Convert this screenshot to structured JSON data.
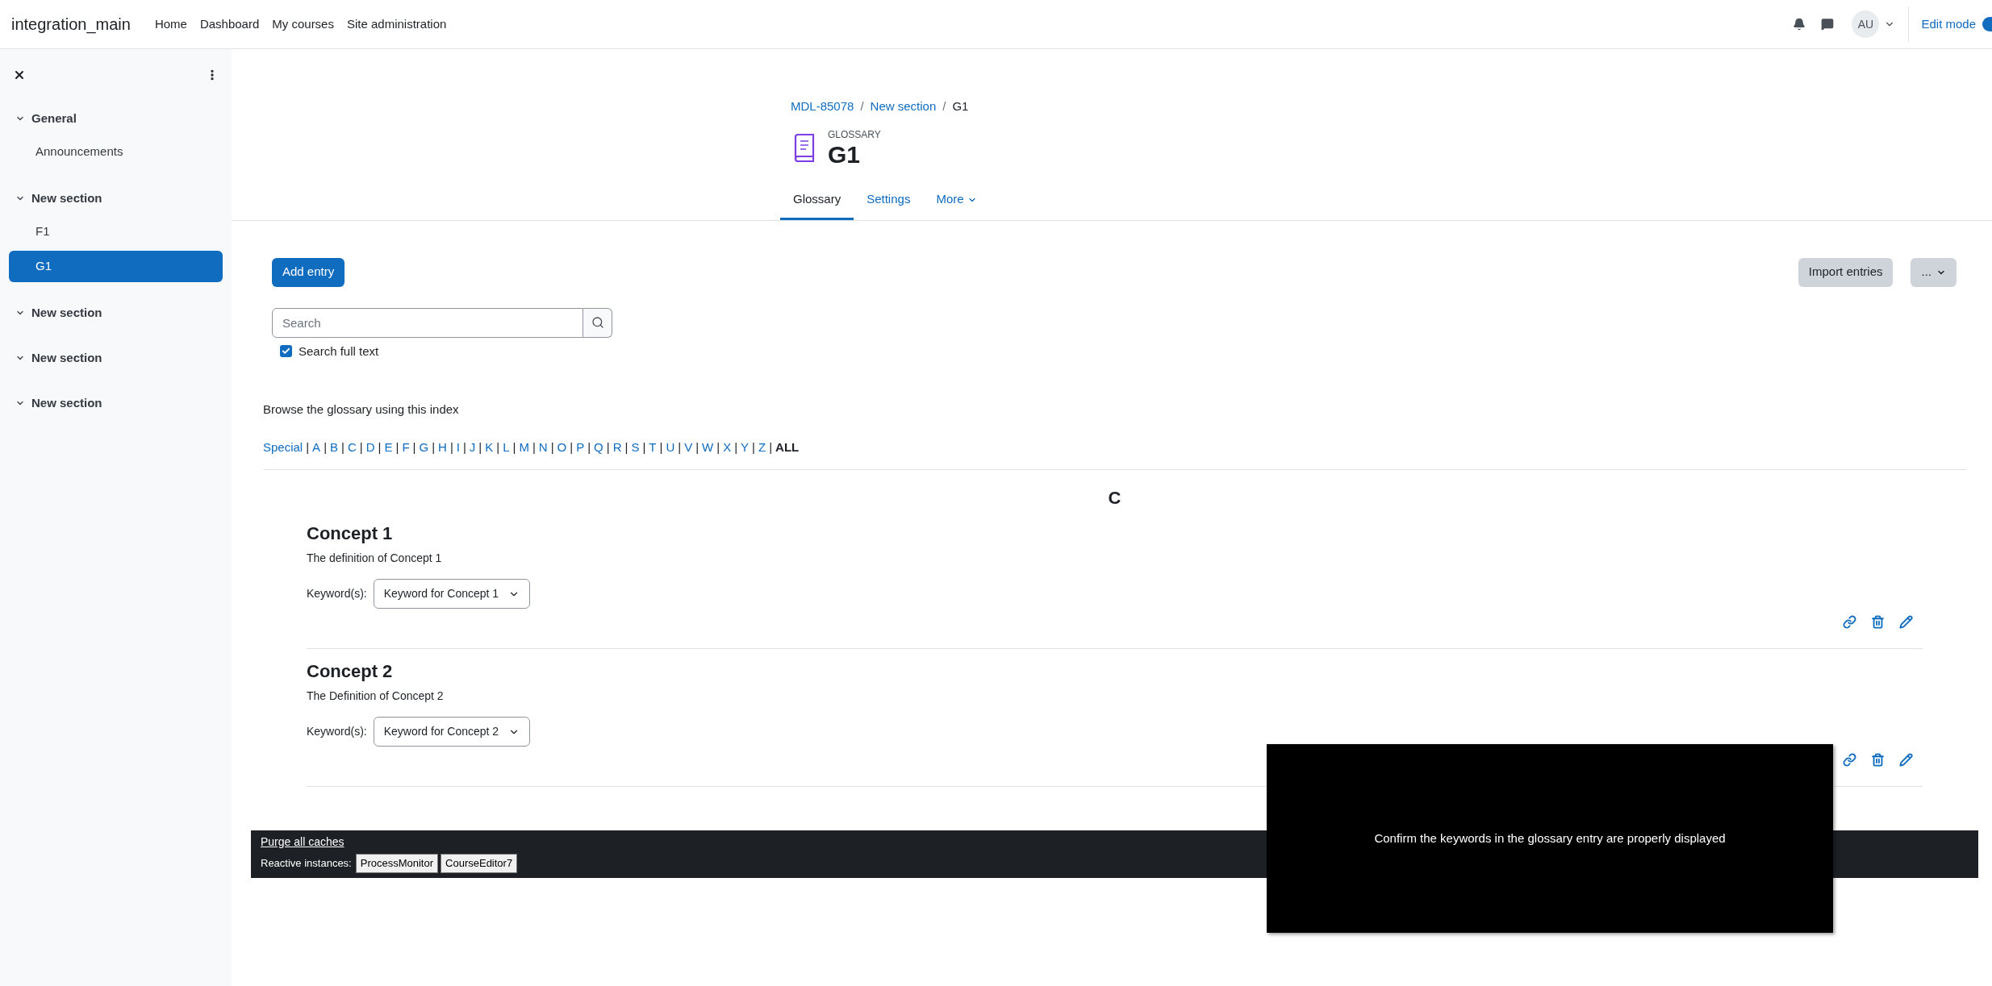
{
  "header": {
    "brand": "integration_main",
    "nav": [
      "Home",
      "Dashboard",
      "My courses",
      "Site administration"
    ],
    "avatar": "AU",
    "edit_mode": {
      "label": "Edit mode",
      "on": true
    }
  },
  "sidebar": {
    "sections": [
      {
        "title": "General",
        "expanded": true,
        "items": [
          {
            "label": "Announcements",
            "selected": false
          }
        ]
      },
      {
        "title": "New section",
        "expanded": true,
        "items": [
          {
            "label": "F1",
            "selected": false
          },
          {
            "label": "G1",
            "selected": true
          }
        ]
      },
      {
        "title": "New section",
        "expanded": true
      },
      {
        "title": "New section",
        "expanded": true
      },
      {
        "title": "New section",
        "expanded": true
      }
    ]
  },
  "page": {
    "breadcrumbs": [
      "MDL-85078",
      "New section",
      "G1"
    ],
    "breadcrumb_separator": "/",
    "module_type": "GLOSSARY",
    "title": "G1",
    "tabs": [
      {
        "label": "Glossary",
        "selected": true,
        "kind": "link"
      },
      {
        "label": "Settings",
        "selected": false,
        "kind": "link"
      },
      {
        "label": "More",
        "selected": false,
        "kind": "dropdown"
      }
    ]
  },
  "actions": {
    "add_entry": "Add entry",
    "import_entries": "Import entries",
    "more_menu": "..."
  },
  "search": {
    "placeholder": "Search",
    "full_text": {
      "label": "Search full text",
      "checked": true
    }
  },
  "index": {
    "caption": "Browse the glossary using this index",
    "separator": "|",
    "letters": [
      {
        "label": "Special",
        "selected": false
      },
      {
        "label": "A",
        "selected": false
      },
      {
        "label": "B",
        "selected": false
      },
      {
        "label": "C",
        "selected": false
      },
      {
        "label": "D",
        "selected": false
      },
      {
        "label": "E",
        "selected": false
      },
      {
        "label": "F",
        "selected": false
      },
      {
        "label": "G",
        "selected": false
      },
      {
        "label": "H",
        "selected": false
      },
      {
        "label": "I",
        "selected": false
      },
      {
        "label": "J",
        "selected": false
      },
      {
        "label": "K",
        "selected": false
      },
      {
        "label": "L",
        "selected": false
      },
      {
        "label": "M",
        "selected": false
      },
      {
        "label": "N",
        "selected": false
      },
      {
        "label": "O",
        "selected": false
      },
      {
        "label": "P",
        "selected": false
      },
      {
        "label": "Q",
        "selected": false
      },
      {
        "label": "R",
        "selected": false
      },
      {
        "label": "S",
        "selected": false
      },
      {
        "label": "T",
        "selected": false
      },
      {
        "label": "U",
        "selected": false
      },
      {
        "label": "V",
        "selected": false
      },
      {
        "label": "W",
        "selected": false
      },
      {
        "label": "X",
        "selected": false
      },
      {
        "label": "Y",
        "selected": false
      },
      {
        "label": "Z",
        "selected": false
      },
      {
        "label": "ALL",
        "selected": true
      }
    ]
  },
  "letter_heading": "C",
  "entries": [
    {
      "concept": "Concept 1",
      "definition": "The definition of Concept 1",
      "keywords_label": "Keyword(s):",
      "keyword": "Keyword for Concept 1"
    },
    {
      "concept": "Concept 2",
      "definition": "The Definition of Concept 2",
      "keywords_label": "Keyword(s):",
      "keyword": "Keyword for Concept 2"
    }
  ],
  "footer": {
    "purge": "Purge all caches",
    "reactive_label": "Reactive instances:",
    "instances": [
      "ProcessMonitor",
      "CourseEditor7"
    ]
  },
  "overlay": {
    "text": "Confirm the keywords in the glossary entry are properly displayed"
  }
}
